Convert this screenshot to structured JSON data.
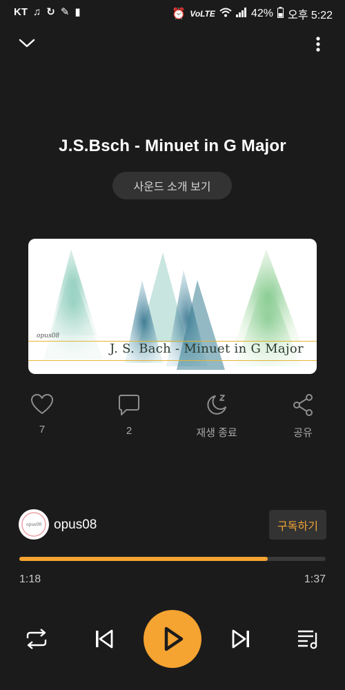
{
  "status_bar": {
    "carrier": "KT",
    "battery_percent": "42%",
    "network": "VoLTE",
    "clock": "오후 5:22"
  },
  "track": {
    "title": "J.S.Bsch - Minuet  in G Major",
    "intro_button_label": "사운드 소개 보기"
  },
  "artwork": {
    "caption": "J. S. Bach - Minuet  in G Major",
    "signature": "opus08"
  },
  "actions": {
    "like_count": "7",
    "comment_count": "2",
    "sleep_timer_label": "재생 종료",
    "share_label": "공유"
  },
  "author": {
    "name": "opus08",
    "avatar_text": "opus08",
    "subscribe_label": "구독하기"
  },
  "playback": {
    "elapsed": "1:18",
    "total": "1:37",
    "progress": 0.81
  },
  "colors": {
    "accent": "#f5a331",
    "background": "#1b1b1b",
    "button_bg": "#333333"
  },
  "icons": [
    "chevron-down-icon",
    "more-vertical-icon",
    "heart-icon",
    "comment-icon",
    "moon-sleep-icon",
    "share-icon",
    "repeat-icon",
    "previous-icon",
    "play-icon",
    "next-icon",
    "playlist-icon"
  ]
}
